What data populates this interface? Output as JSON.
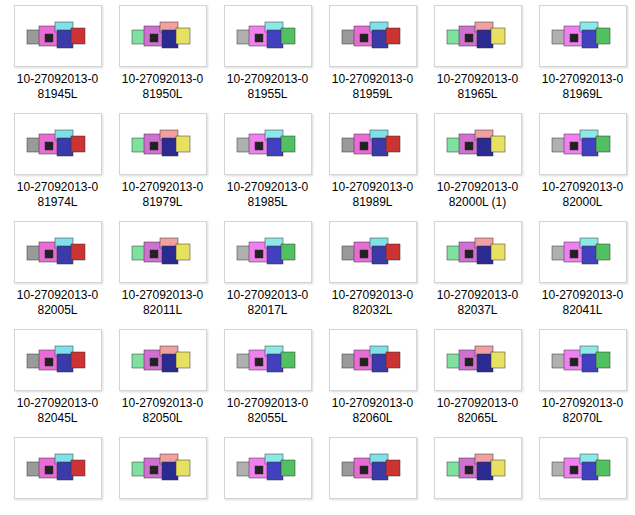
{
  "files": [
    {
      "label_lines": [
        "10-27092013-0",
        "81945L"
      ]
    },
    {
      "label_lines": [
        "10-27092013-0",
        "81950L"
      ]
    },
    {
      "label_lines": [
        "10-27092013-0",
        "81955L"
      ]
    },
    {
      "label_lines": [
        "10-27092013-0",
        "81959L"
      ]
    },
    {
      "label_lines": [
        "10-27092013-0",
        "81965L"
      ]
    },
    {
      "label_lines": [
        "10-27092013-0",
        "81969L"
      ]
    },
    {
      "label_lines": [
        "10-27092013-0",
        "81974L"
      ]
    },
    {
      "label_lines": [
        "10-27092013-0",
        "81979L"
      ]
    },
    {
      "label_lines": [
        "10-27092013-0",
        "81985L"
      ]
    },
    {
      "label_lines": [
        "10-27092013-0",
        "81989L"
      ]
    },
    {
      "label_lines": [
        "10-27092013-0",
        "82000L (1)"
      ]
    },
    {
      "label_lines": [
        "10-27092013-0",
        "82000L"
      ]
    },
    {
      "label_lines": [
        "10-27092013-0",
        "82005L"
      ]
    },
    {
      "label_lines": [
        "10-27092013-0",
        "82011L"
      ]
    },
    {
      "label_lines": [
        "10-27092013-0",
        "82017L"
      ]
    },
    {
      "label_lines": [
        "10-27092013-0",
        "82032L"
      ]
    },
    {
      "label_lines": [
        "10-27092013-0",
        "82037L"
      ]
    },
    {
      "label_lines": [
        "10-27092013-0",
        "82041L"
      ]
    },
    {
      "label_lines": [
        "10-27092013-0",
        "82045L"
      ]
    },
    {
      "label_lines": [
        "10-27092013-0",
        "82050L"
      ]
    },
    {
      "label_lines": [
        "10-27092013-0",
        "82055L"
      ]
    },
    {
      "label_lines": [
        "10-27092013-0",
        "82060L"
      ]
    },
    {
      "label_lines": [
        "10-27092013-0",
        "82065L"
      ]
    },
    {
      "label_lines": [
        "10-27092013-0",
        "82070L"
      ]
    },
    {
      "label_lines": []
    },
    {
      "label_lines": []
    },
    {
      "label_lines": []
    },
    {
      "label_lines": []
    },
    {
      "label_lines": []
    },
    {
      "label_lines": []
    }
  ]
}
